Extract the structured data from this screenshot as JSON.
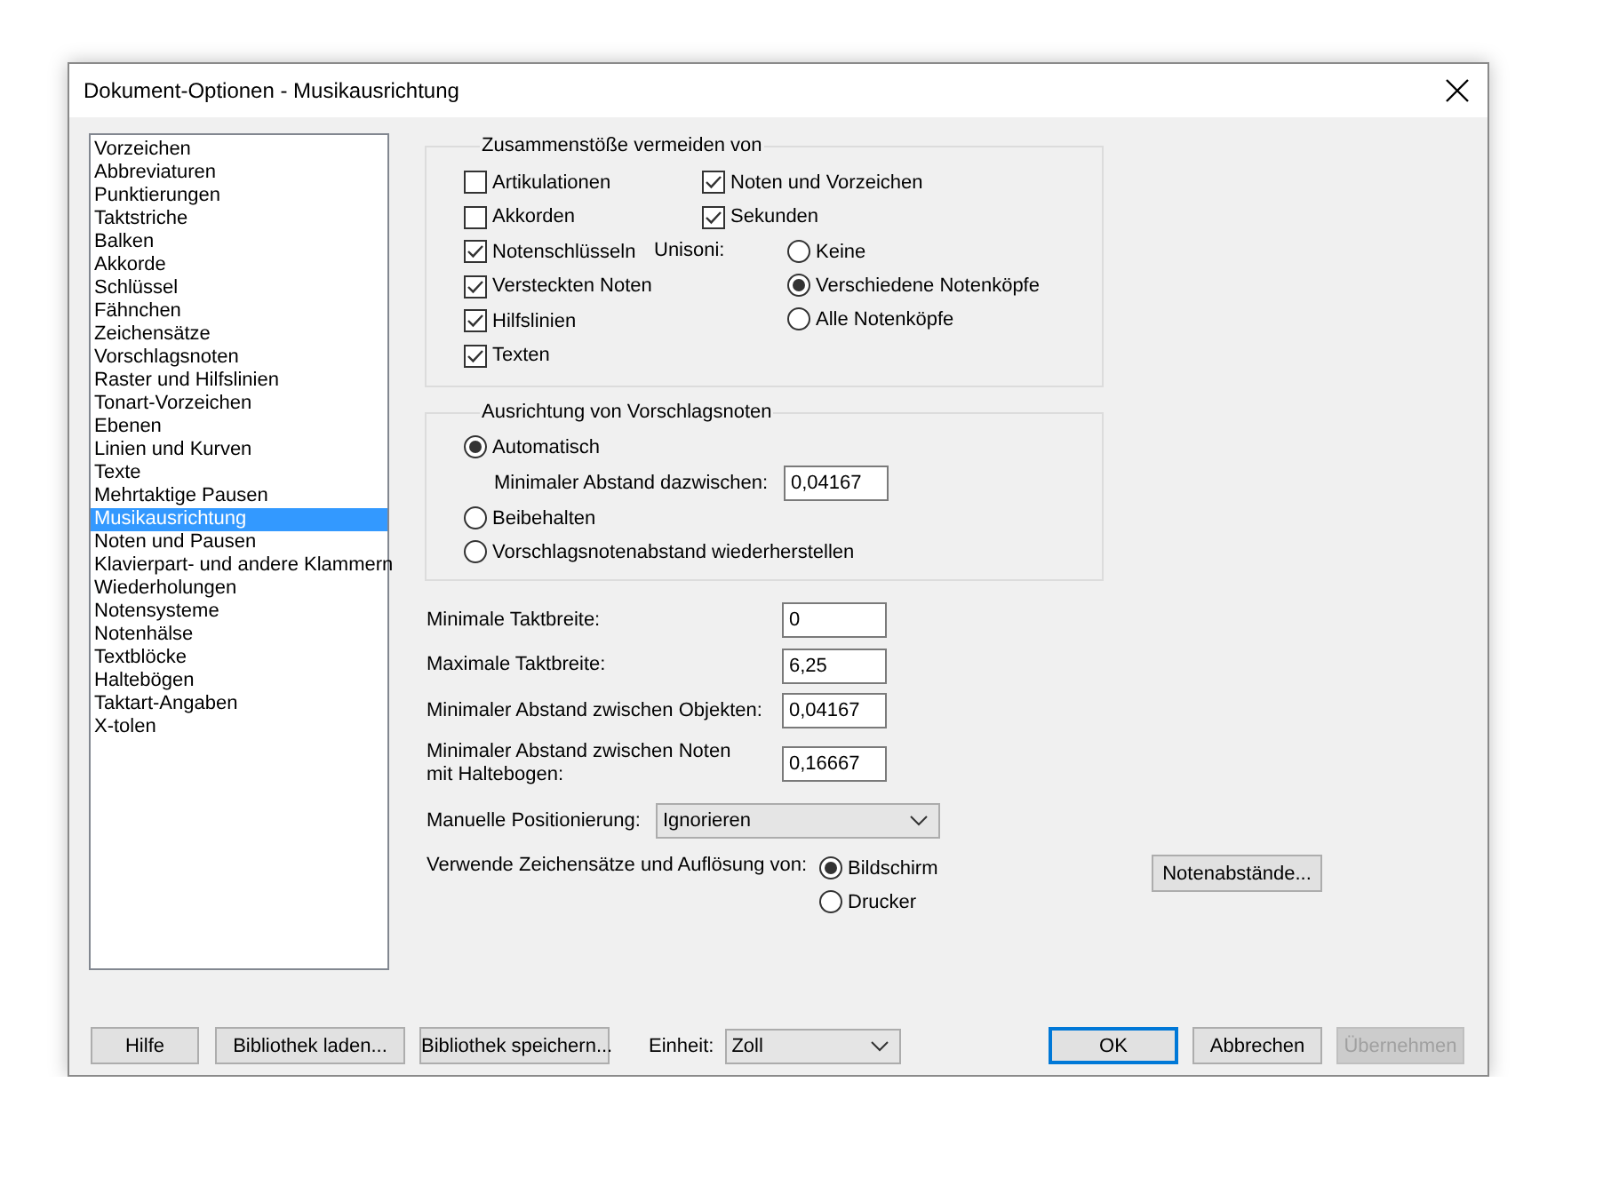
{
  "window": {
    "title": "Dokument-Optionen - Musikausrichtung"
  },
  "sidebar": {
    "items": [
      {
        "label": "Vorzeichen",
        "selected": false
      },
      {
        "label": "Abbreviaturen",
        "selected": false
      },
      {
        "label": "Punktierungen",
        "selected": false
      },
      {
        "label": "Taktstriche",
        "selected": false
      },
      {
        "label": "Balken",
        "selected": false
      },
      {
        "label": "Akkorde",
        "selected": false
      },
      {
        "label": "Schlüssel",
        "selected": false
      },
      {
        "label": "Fähnchen",
        "selected": false
      },
      {
        "label": "Zeichensätze",
        "selected": false
      },
      {
        "label": "Vorschlagsnoten",
        "selected": false
      },
      {
        "label": "Raster und Hilfslinien",
        "selected": false
      },
      {
        "label": "Tonart-Vorzeichen",
        "selected": false
      },
      {
        "label": "Ebenen",
        "selected": false
      },
      {
        "label": "Linien und Kurven",
        "selected": false
      },
      {
        "label": "Texte",
        "selected": false
      },
      {
        "label": "Mehrtaktige Pausen",
        "selected": false
      },
      {
        "label": "Musikausrichtung",
        "selected": true
      },
      {
        "label": "Noten und Pausen",
        "selected": false
      },
      {
        "label": "Klavierpart- und andere Klammern",
        "selected": false
      },
      {
        "label": "Wiederholungen",
        "selected": false
      },
      {
        "label": "Notensysteme",
        "selected": false
      },
      {
        "label": "Notenhälse",
        "selected": false
      },
      {
        "label": "Textblöcke",
        "selected": false
      },
      {
        "label": "Haltebögen",
        "selected": false
      },
      {
        "label": "Taktart-Angaben",
        "selected": false
      },
      {
        "label": "X-tolen",
        "selected": false
      }
    ]
  },
  "collision_group": {
    "title": "Zusammenstöße vermeiden von",
    "column_1": [
      {
        "label": "Artikulationen",
        "checked": false
      },
      {
        "label": "Akkorden",
        "checked": false
      },
      {
        "label": "Notenschlüsseln",
        "checked": true
      },
      {
        "label": "Versteckten Noten",
        "checked": true
      },
      {
        "label": "Hilfslinien",
        "checked": true
      },
      {
        "label": "Texten",
        "checked": true
      }
    ],
    "column_2": [
      {
        "label": "Noten und Vorzeichen",
        "checked": true
      },
      {
        "label": "Sekunden",
        "checked": true
      }
    ],
    "unisoni": {
      "label": "Unisoni:",
      "options": [
        {
          "label": "Keine",
          "selected": false
        },
        {
          "label": "Verschiedene Notenköpfe",
          "selected": true
        },
        {
          "label": "Alle Notenköpfe",
          "selected": false
        }
      ]
    }
  },
  "grace_note_group": {
    "title": "Ausrichtung von Vorschlagsnoten",
    "options": [
      {
        "label": "Automatisch",
        "selected": true,
        "field": {
          "label": "Minimaler Abstand dazwischen:",
          "value": "0,04167"
        }
      },
      {
        "label": "Beibehalten",
        "selected": false
      },
      {
        "label": "Vorschlagsnotenabstand wiederherstellen",
        "selected": false
      }
    ]
  },
  "measure_fields": [
    {
      "label": "Minimale Taktbreite:",
      "value": "0"
    },
    {
      "label": "Maximale Taktbreite:",
      "value": "6,25"
    },
    {
      "label": "Minimaler Abstand zwischen Objekten:",
      "value": "0,04167"
    },
    {
      "label": "Minimaler Abstand zwischen Noten mit Haltebogen:",
      "value": "0,16667"
    }
  ],
  "manual_positioning": {
    "label": "Manuelle Positionierung:",
    "value": "Ignorieren"
  },
  "fonts_resolution": {
    "label": "Verwende Zeichensätze und Auflösung von:",
    "options": [
      {
        "label": "Bildschirm",
        "selected": true
      },
      {
        "label": "Drucker",
        "selected": false
      }
    ]
  },
  "spacing_button": {
    "label": "Notenabstände..."
  },
  "footer": {
    "left_buttons": [
      {
        "label": "Hilfe"
      },
      {
        "label": "Bibliothek laden..."
      },
      {
        "label": "Bibliothek speichern..."
      }
    ],
    "unit": {
      "label": "Einheit:",
      "value": "Zoll"
    },
    "right_buttons": [
      {
        "label": "OK",
        "default": true,
        "disabled": false
      },
      {
        "label": "Abbrechen",
        "default": false,
        "disabled": false
      },
      {
        "label": "Übernehmen",
        "default": false,
        "disabled": true
      }
    ]
  }
}
